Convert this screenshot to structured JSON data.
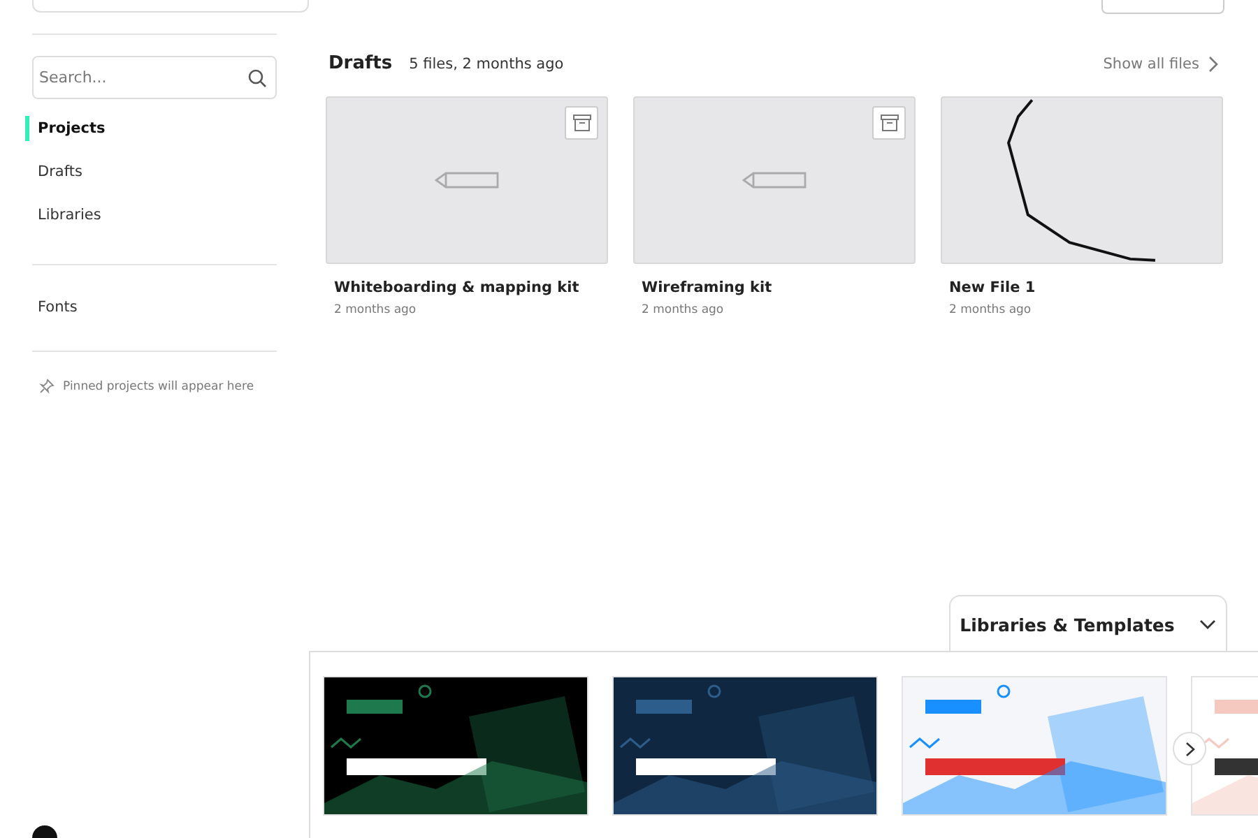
{
  "sidebar": {
    "search": {
      "placeholder": "Search..."
    },
    "nav": [
      {
        "label": "Projects",
        "selected": true
      },
      {
        "label": "Drafts",
        "selected": false
      },
      {
        "label": "Libraries",
        "selected": false
      }
    ],
    "fonts": {
      "label": "Fonts",
      "selected": false
    },
    "pinned_hint": "Pinned projects will appear here"
  },
  "drafts": {
    "title": "Drafts",
    "summary": "5 files, 2 months ago",
    "show_all": "Show all files",
    "files": [
      {
        "name": "Whiteboarding & mapping kit",
        "time": "2 months ago",
        "kind": "placeholder"
      },
      {
        "name": "Wireframing kit",
        "time": "2 months ago",
        "kind": "placeholder"
      },
      {
        "name": "New File 1",
        "time": "2 months ago",
        "kind": "sketch"
      }
    ]
  },
  "templates": {
    "title": "Libraries & Templates",
    "expanded": true
  }
}
